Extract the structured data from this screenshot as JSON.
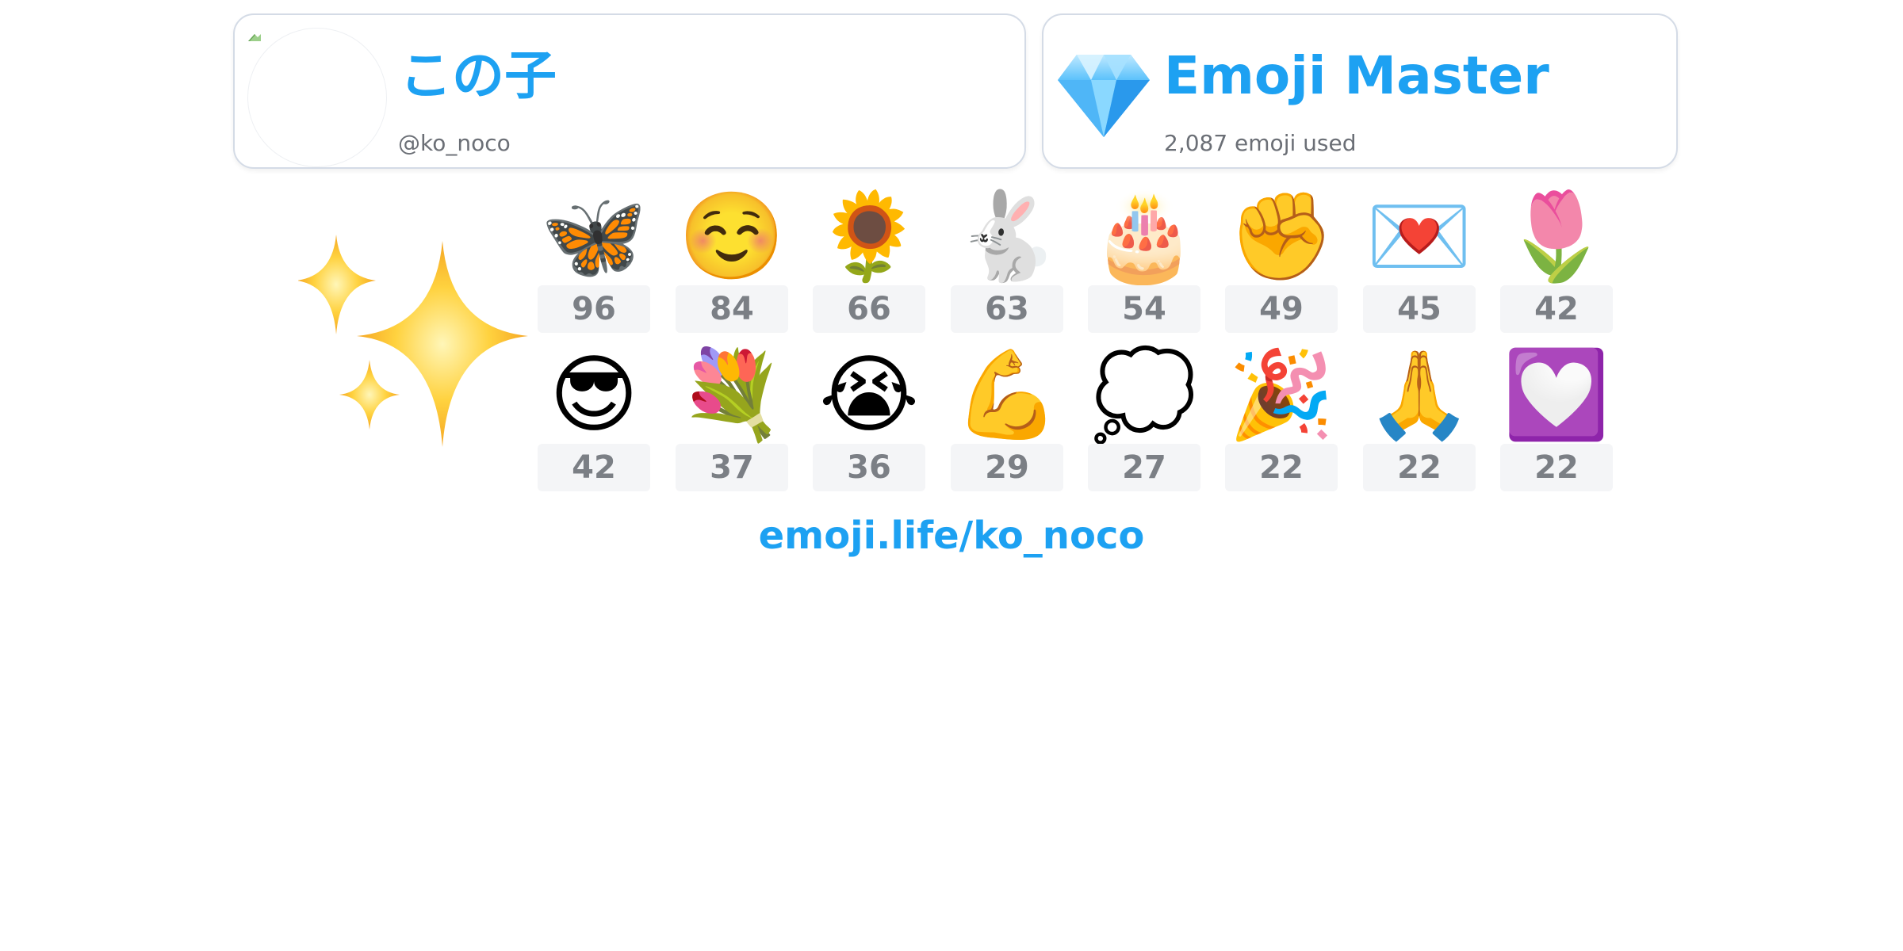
{
  "profile": {
    "display_name": "この子",
    "handle": "@ko_noco"
  },
  "rank": {
    "title": "Emoji Master",
    "stat": "2,087 emoji used",
    "icon": "gem-icon"
  },
  "decoration": {
    "icon": "sparkles-icon"
  },
  "emojis": [
    {
      "emoji": "🦋",
      "name": "butterfly",
      "count": "96"
    },
    {
      "emoji": "☺️",
      "name": "smiling-face",
      "count": "84"
    },
    {
      "emoji": "🌻",
      "name": "sunflower",
      "count": "66"
    },
    {
      "emoji": "🐇",
      "name": "rabbit",
      "count": "63"
    },
    {
      "emoji": "🎂",
      "name": "birthday-cake",
      "count": "54"
    },
    {
      "emoji": "✊",
      "name": "raised-fist",
      "count": "49"
    },
    {
      "emoji": "💌",
      "name": "love-letter",
      "count": "45"
    },
    {
      "emoji": "🌷",
      "name": "tulip",
      "count": "42"
    },
    {
      "emoji": "😎",
      "name": "sunglasses-face",
      "count": "42"
    },
    {
      "emoji": "💐",
      "name": "bouquet",
      "count": "37"
    },
    {
      "emoji": "😭",
      "name": "loudly-crying-face",
      "count": "36"
    },
    {
      "emoji": "💪",
      "name": "flexed-biceps",
      "count": "29"
    },
    {
      "emoji": "💭",
      "name": "thought-balloon",
      "count": "27"
    },
    {
      "emoji": "🎉",
      "name": "party-popper",
      "count": "22"
    },
    {
      "emoji": "🙏",
      "name": "folded-hands",
      "count": "22"
    },
    {
      "emoji": "💟",
      "name": "heart-decoration",
      "count": "22"
    }
  ],
  "footer": {
    "link": "emoji.life/ko_noco"
  },
  "colors": {
    "accent": "#1da1f2",
    "muted_text": "#6b6f76",
    "count_text": "#7b7f85",
    "count_bg": "#f4f5f7",
    "card_border": "#d4dbe6"
  }
}
